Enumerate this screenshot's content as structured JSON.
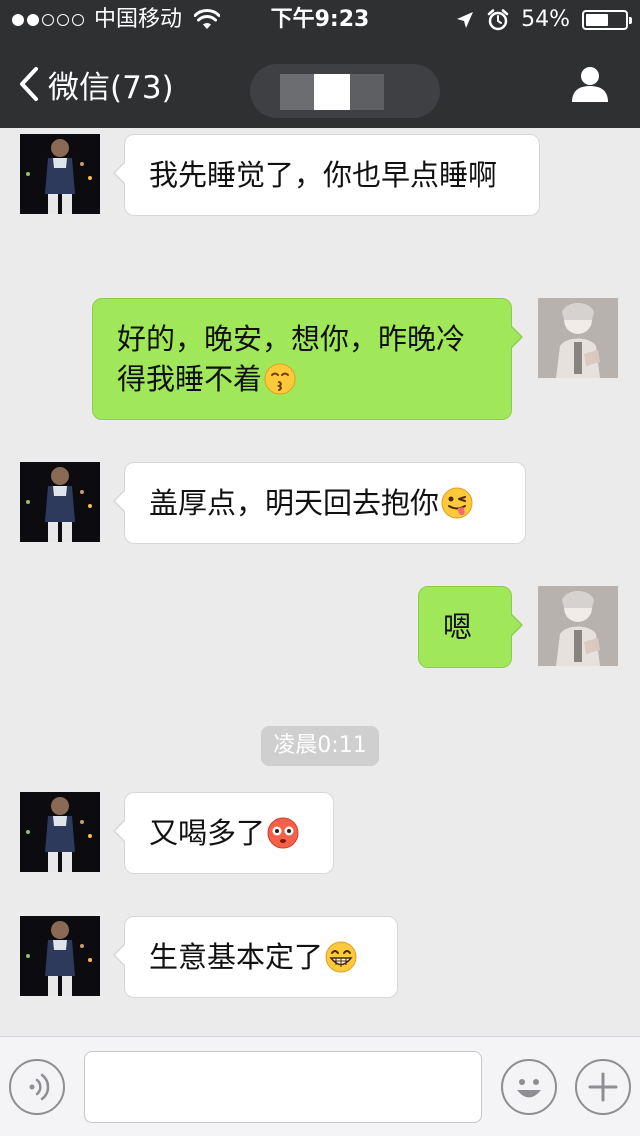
{
  "status_bar": {
    "carrier": "中国移动",
    "time": "下午9:23",
    "battery": "54%",
    "battery_level": 0.54,
    "signal_strength": 2
  },
  "nav": {
    "back_label": "微信(73)",
    "icons": {
      "back": "chevron-left-icon",
      "profile": "person-icon"
    }
  },
  "messages": [
    {
      "side": "in",
      "text": "我先睡觉了，你也早点睡啊",
      "emoji": null
    },
    {
      "side": "out",
      "text": "好的，晚安，想你，昨晚冷得我睡不着",
      "emoji": "kissing-face"
    },
    {
      "side": "in",
      "text": "盖厚点，明天回去抱你",
      "emoji": "winking-tongue-face"
    },
    {
      "side": "out",
      "text": "嗯",
      "emoji": null
    },
    {
      "side": "in",
      "text": "又喝多了",
      "emoji": "flushed-face"
    },
    {
      "side": "in",
      "text": "生意基本定了",
      "emoji": "grinning-face"
    }
  ],
  "timestamp_divider": "凌晨0:11",
  "input_bar": {
    "placeholder": "",
    "icons": {
      "voice": "voice-icon",
      "emoji": "smiley-icon",
      "more": "plus-icon"
    }
  },
  "colors": {
    "nav_background": "#2e3032",
    "chat_background": "#ebebeb",
    "outgoing_bubble": "#a0e75a",
    "incoming_bubble": "#ffffff"
  }
}
